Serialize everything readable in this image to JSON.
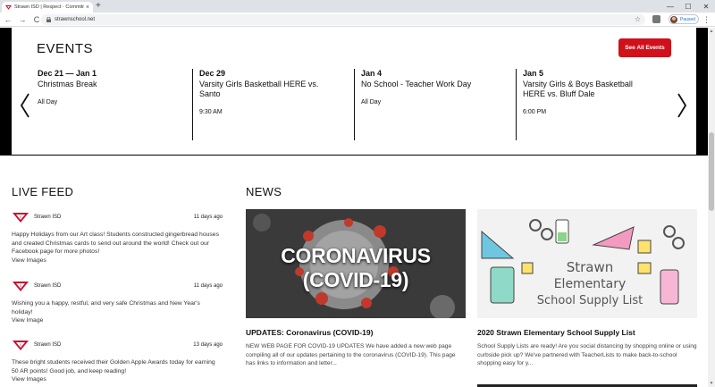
{
  "browser": {
    "tab_title": "Strawn ISD | Respect · Commitm",
    "url": "strawnschool.net",
    "profile_label": "Paused",
    "new_tab": "+",
    "tab_close": "×",
    "win_minimize": "—",
    "win_maximize": "☐",
    "win_close": "✕",
    "back": "←",
    "forward": "→",
    "reload": "C",
    "star": "☆",
    "menu": "⋮"
  },
  "events": {
    "heading": "EVENTS",
    "see_all_label": "See All Events",
    "items": [
      {
        "date": "Dec 21 — Jan 1",
        "title": "Christmas Break",
        "time": "All Day"
      },
      {
        "date": "Dec 29",
        "title": "Varsity Girls Basketball HERE vs. Santo",
        "time": "9:30 AM"
      },
      {
        "date": "Jan 4",
        "title": "No School - Teacher Work Day",
        "time": "All Day"
      },
      {
        "date": "Jan 5",
        "title": "Varsity Girls & Boys Basketball HERE vs. Bluff Dale",
        "time": "6:00 PM"
      }
    ]
  },
  "live_feed": {
    "heading": "LIVE FEED",
    "items": [
      {
        "author": "Strawn ISD",
        "time": "11 days ago",
        "text": "Happy Holidays from our Art class! Students constructed gingerbread houses and created Christmas cards to send out around the world! Check out our Facebook page for more photos!",
        "link": "View Images"
      },
      {
        "author": "Strawn ISD",
        "time": "11 days ago",
        "text": "Wishing you a happy, restful, and very safe Christmas and New Year's holiday!",
        "link": "View Image"
      },
      {
        "author": "Strawn ISD",
        "time": "13 days ago",
        "text": "These bright students received their Golden Apple Awards today for earning 50 AR points! Good job, and keep reading!",
        "link": "View Images"
      }
    ]
  },
  "news": {
    "heading": "NEWS",
    "items": [
      {
        "image_text": "CORONAVIRUS (COVID-19)",
        "title": "UPDATES: Coronavirus (COVID-19)",
        "excerpt": "NEW WEB PAGE FOR COVID-19 UPDATES We have added a new web page compiling all of our updates pertaining to the coronavirus (COVID-19). This page has links to information and letter..."
      },
      {
        "image_text_line1": "Strawn",
        "image_text_line2": "Elementary",
        "image_text_line3": "School Supply List",
        "title": "2020 Strawn Elementary School Supply List",
        "excerpt": "School Supply Lists are ready! Are you social distancing by shopping online or using curbside pick up? We've partnered with TeacherLists to make back-to-school shopping easy for y..."
      }
    ]
  },
  "colors": {
    "accent_red": "#d0111b",
    "band_black": "#000000"
  }
}
